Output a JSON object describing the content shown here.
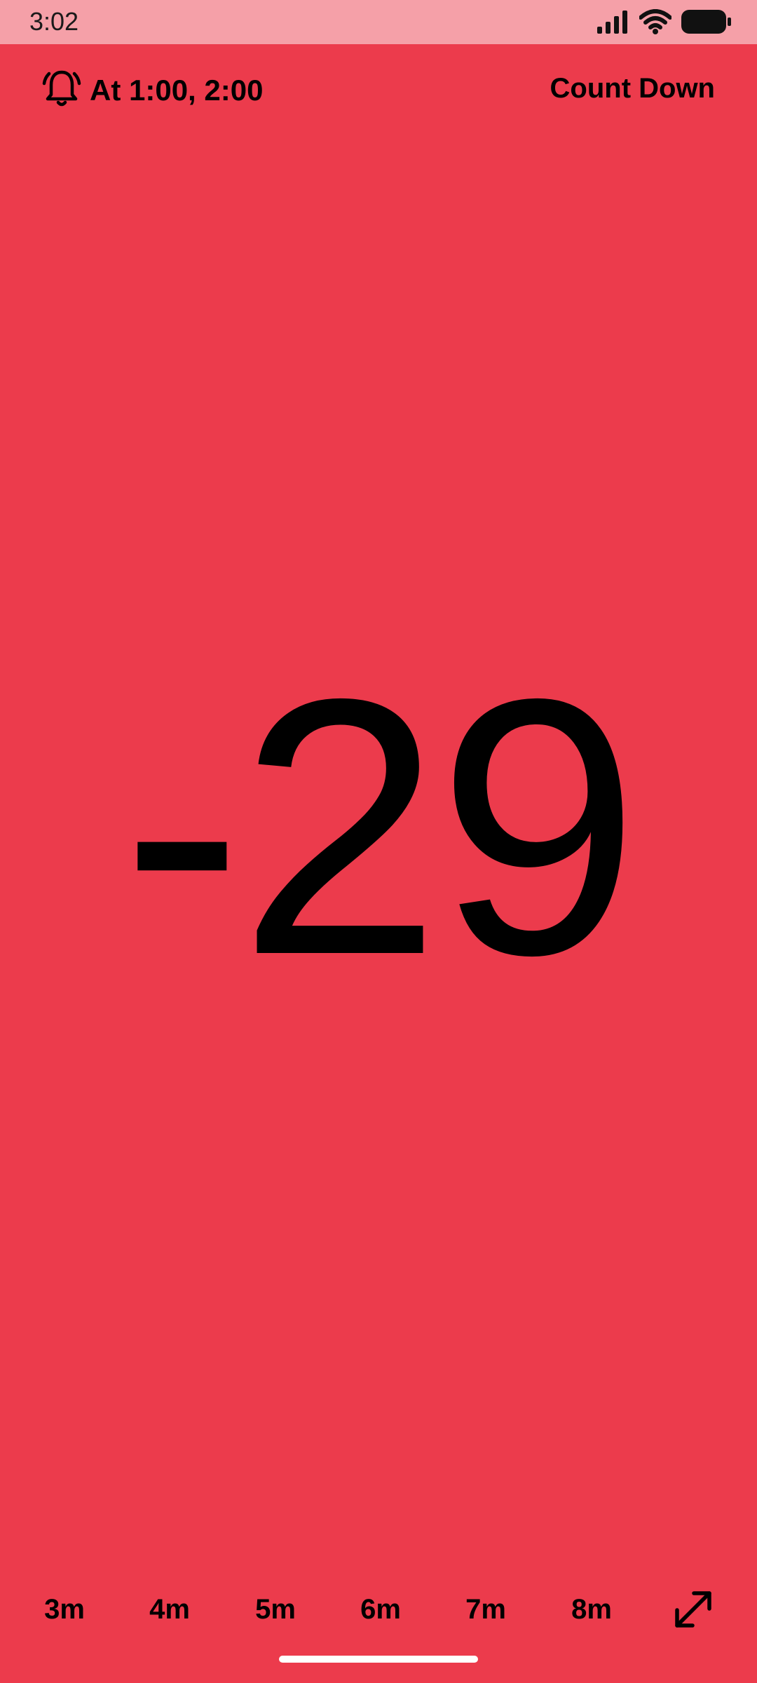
{
  "status_bar": {
    "time": "3:02",
    "icons": [
      "signal-icon",
      "wifi-icon",
      "battery-icon"
    ]
  },
  "header": {
    "alarm_icon": "alarm-bell-icon",
    "alarm_label": "At 1:00, 2:00",
    "mode_label": "Count Down"
  },
  "timer": {
    "value": "-29"
  },
  "presets": [
    {
      "label": "3m"
    },
    {
      "label": "4m"
    },
    {
      "label": "5m"
    },
    {
      "label": "6m"
    },
    {
      "label": "7m"
    },
    {
      "label": "8m"
    }
  ],
  "expand_icon": "expand-icon",
  "colors": {
    "background": "#EC3B4C",
    "status_bar": "#F5A0A8",
    "text": "#000000"
  }
}
